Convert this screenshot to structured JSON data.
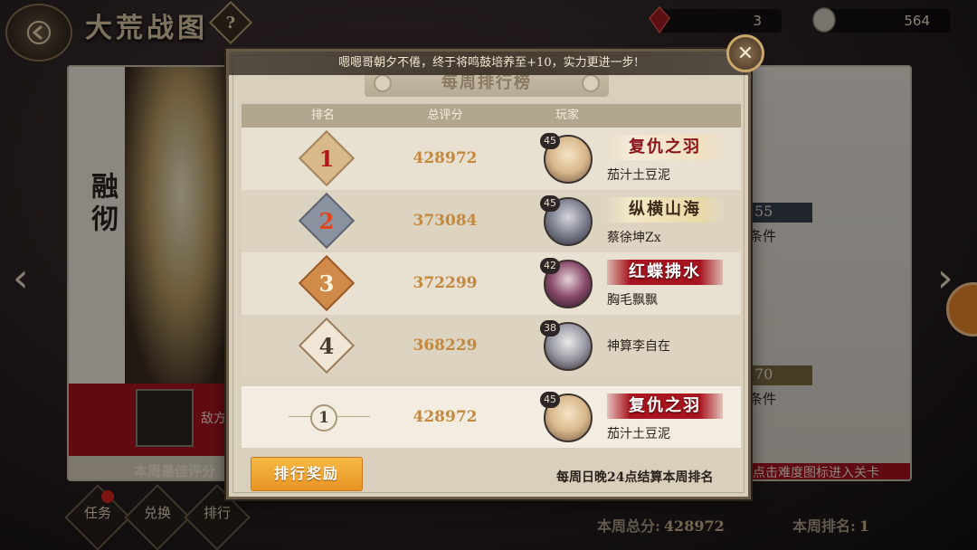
{
  "header": {
    "title": "大荒战图",
    "help_icon_text": "?",
    "currency_1": "3",
    "currency_2": "564"
  },
  "left_card": {
    "name": "融彻",
    "enemy_text": "敌方",
    "best_text": "本周最佳评分"
  },
  "right_card": {
    "bar1_value": "55",
    "label1": "条件",
    "bar2_value": "70",
    "label2": "条件",
    "bottom_text": "点击难度图标进入关卡"
  },
  "bottom_nav": [
    {
      "label": "任务"
    },
    {
      "label": "兑换"
    },
    {
      "label": "排行"
    }
  ],
  "footer": {
    "weekly_total_label": "本周总分:",
    "weekly_total_value": "428972",
    "weekly_rank_label": "本周排名:",
    "weekly_rank_value": "1"
  },
  "modal": {
    "banner": "嗯嗯哥朝夕不倦，终于将鸣鼓培养至+10，实力更进一步!",
    "title": "每周排行榜",
    "columns": [
      "排名",
      "总评分",
      "玩家"
    ],
    "rows": [
      {
        "rank": "1",
        "score": "428972",
        "level": "45",
        "tag": "复仇之羽",
        "name": "茄汁土豆泥"
      },
      {
        "rank": "2",
        "score": "373084",
        "level": "45",
        "tag": "纵横山海",
        "name": "蔡徐坤Zx"
      },
      {
        "rank": "3",
        "score": "372299",
        "level": "42",
        "tag": "红蝶拂水",
        "name": "胸毛飘飘"
      },
      {
        "rank": "4",
        "score": "368229",
        "level": "38",
        "tag": "",
        "name": "神算李自在"
      }
    ],
    "self_row": {
      "rank": "1",
      "score": "428972",
      "level": "45",
      "tag": "复仇之羽",
      "name": "茄汁土豆泥"
    },
    "reward_button": "排行奖励",
    "settle_note": "每周日晚24点结算本周排名"
  },
  "colors": {
    "score_gold": "#c4893c",
    "accent_red": "#a8141f",
    "reward_orange": "#e89424",
    "rank1": "#c98a3c",
    "rank2": "#6d7888",
    "rank3": "#c36f2e",
    "rank4": "#e8dccb"
  }
}
